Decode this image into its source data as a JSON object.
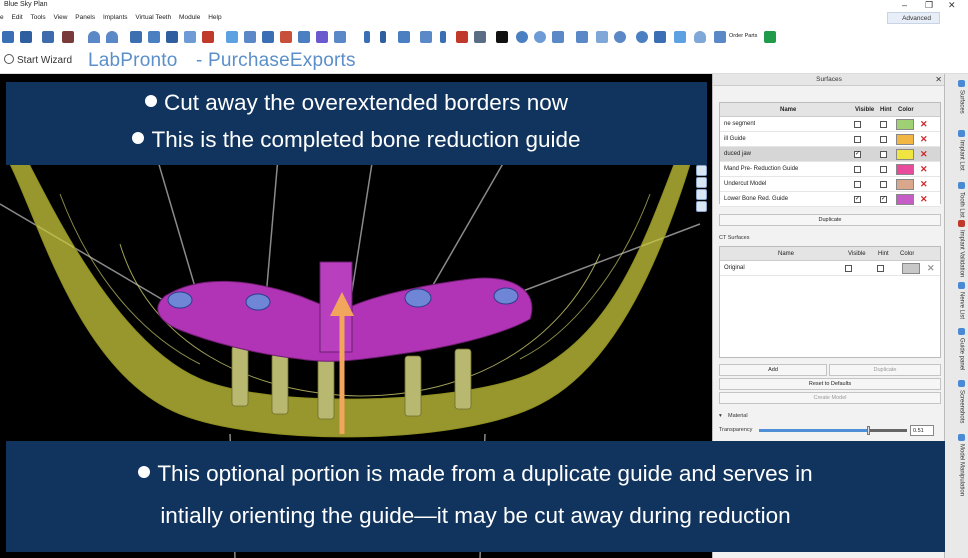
{
  "window": {
    "title": "Blue Sky Plan",
    "controls": [
      "–",
      "❐",
      "✕"
    ]
  },
  "menu": {
    "items": [
      "e",
      "Edit",
      "Tools",
      "View",
      "Panels",
      "Implants",
      "Virtual Teeth",
      "Module",
      "Help"
    ],
    "advanced_label": "Advanced"
  },
  "toolbar": {
    "order_parts_label": "Order Parts",
    "start_wizard_label": "Start Wizard",
    "brand_labpronto": "LabPronto",
    "brand_separator": "-",
    "brand_purchase": "PurchaseExports"
  },
  "annotations": {
    "top": [
      "Cut away the overextended borders now",
      "This is the completed bone reduction guide"
    ],
    "bottom": [
      "This optional portion is made from a duplicate guide and serves in",
      "intially orienting the guide—it may be cut away during reduction"
    ]
  },
  "surfaces_panel": {
    "title": "Surfaces",
    "columns": [
      "Name",
      "Visible",
      "Hint",
      "Color"
    ],
    "rows": [
      {
        "name": "ne segment",
        "visible": false,
        "hint": false,
        "color": "#9fd074",
        "selected": false
      },
      {
        "name": "ill Guide",
        "visible": false,
        "hint": false,
        "color": "#f2b642",
        "selected": false
      },
      {
        "name": "duced jaw",
        "visible": true,
        "hint": false,
        "color": "#f0e440",
        "selected": true
      },
      {
        "name": "Mand Pre- Reduction Guide",
        "visible": false,
        "hint": false,
        "color": "#e84b9b",
        "selected": false
      },
      {
        "name": "Undercut Model",
        "visible": false,
        "hint": false,
        "color": "#d9a88c",
        "selected": false
      },
      {
        "name": "Lower Bone Red. Guide",
        "visible": true,
        "hint": true,
        "color": "#c65cc6",
        "selected": false
      }
    ],
    "duplicate_label": "Duplicate"
  },
  "ct_surfaces": {
    "title": "CT Surfaces",
    "columns": [
      "Name",
      "Visible",
      "Hint",
      "Color"
    ],
    "rows": [
      {
        "name": "Original",
        "visible": false,
        "hint": false,
        "color": "#c8c8c8"
      }
    ],
    "add_label": "Add",
    "duplicate_label": "Duplicate",
    "reset_label": "Reset to Defaults",
    "create_model_label": "Create Model"
  },
  "material": {
    "title": "Material",
    "transparency_label": "Transparency",
    "transparency_value": "0.51",
    "transparency_level": 0.51
  },
  "side_tabs": [
    "Surfaces",
    "Implant List",
    "Tooth List",
    "Implant Validation",
    "Nerve List",
    "Guide panel",
    "Screenshots",
    "Model Manipulation"
  ],
  "colors": {
    "banner": "#11345e",
    "guide_magenta": "#b234b6",
    "bone_yellow": "#c9c93e",
    "arrow_orange": "#f2a55c",
    "brand_blue": "#5b8fc9",
    "delete_red": "#d0282a"
  }
}
